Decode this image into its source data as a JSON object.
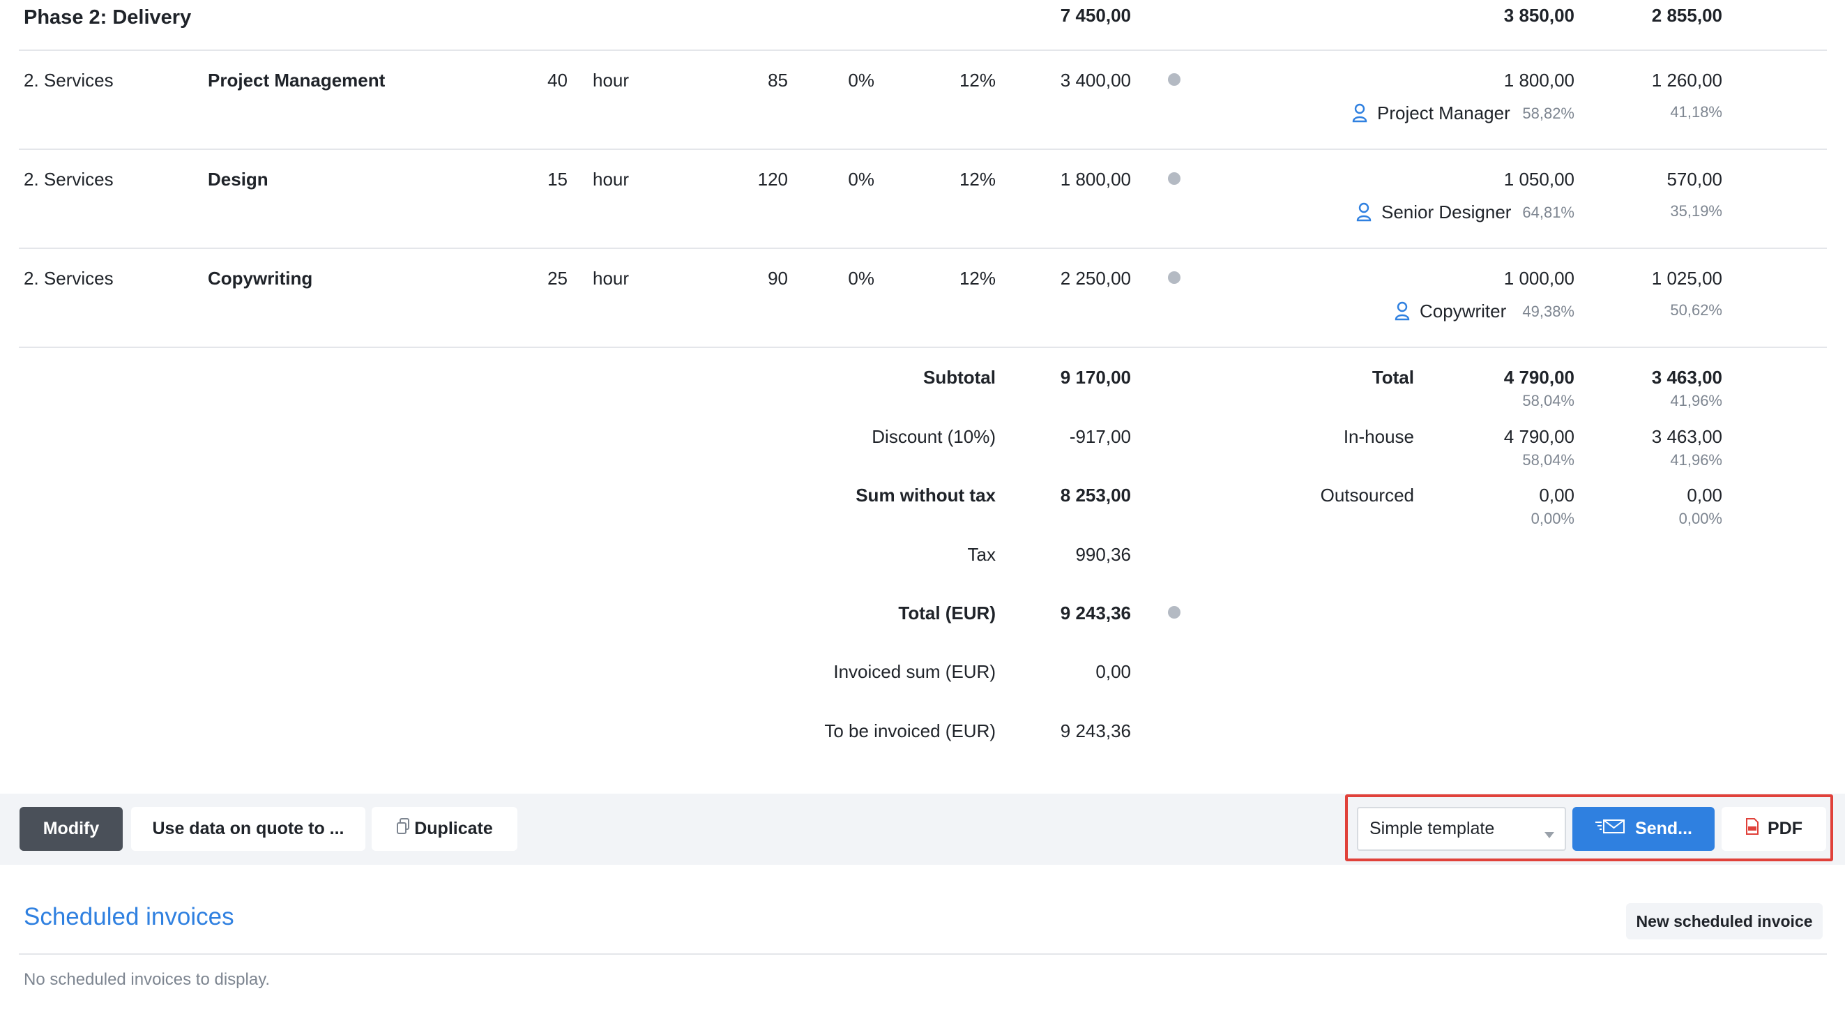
{
  "phase": {
    "title": "Phase 2: Delivery",
    "price": "7 450,00",
    "cost": "3 850,00",
    "margin": "2 855,00"
  },
  "rows": [
    {
      "category": "2. Services",
      "name": "Project Management",
      "qty": "40",
      "unit": "hour",
      "unit_price": "85",
      "discount": "0%",
      "tax": "12%",
      "amount": "3 400,00",
      "cost": "1 800,00",
      "margin": "1 260,00",
      "role": "Project Manager",
      "cost_pct": "58,82%",
      "margin_pct": "41,18%"
    },
    {
      "category": "2. Services",
      "name": "Design",
      "qty": "15",
      "unit": "hour",
      "unit_price": "120",
      "discount": "0%",
      "tax": "12%",
      "amount": "1 800,00",
      "cost": "1 050,00",
      "margin": "570,00",
      "role": "Senior Designer",
      "cost_pct": "64,81%",
      "margin_pct": "35,19%"
    },
    {
      "category": "2. Services",
      "name": "Copywriting",
      "qty": "25",
      "unit": "hour",
      "unit_price": "90",
      "discount": "0%",
      "tax": "12%",
      "amount": "2 250,00",
      "cost": "1 000,00",
      "margin": "1 025,00",
      "role": "Copywriter",
      "cost_pct": "49,38%",
      "margin_pct": "50,62%"
    }
  ],
  "totals": {
    "subtotal_label": "Subtotal",
    "subtotal": "9 170,00",
    "discount_label": "Discount (10%)",
    "discount": "-917,00",
    "sum_without_tax_label": "Sum without tax",
    "sum_without_tax": "8 253,00",
    "tax_label": "Tax",
    "tax": "990,36",
    "total_label": "Total (EUR)",
    "total": "9 243,36",
    "invoiced_label": "Invoiced sum (EUR)",
    "invoiced": "0,00",
    "to_invoice_label": "To be invoiced (EUR)",
    "to_invoice": "9 243,36"
  },
  "breakdown": {
    "total": {
      "label": "Total",
      "cost": "4 790,00",
      "cost_pct": "58,04%",
      "margin": "3 463,00",
      "margin_pct": "41,96%"
    },
    "inhouse": {
      "label": "In-house",
      "cost": "4 790,00",
      "cost_pct": "58,04%",
      "margin": "3 463,00",
      "margin_pct": "41,96%"
    },
    "outsourced": {
      "label": "Outsourced",
      "cost": "0,00",
      "cost_pct": "0,00%",
      "margin": "0,00",
      "margin_pct": "0,00%"
    }
  },
  "actions": {
    "modify": "Modify",
    "use_data": "Use data on quote to ...",
    "duplicate": "Duplicate",
    "template_value": "Simple template",
    "send": "Send...",
    "pdf": "PDF"
  },
  "scheduled": {
    "title": "Scheduled invoices",
    "new_button": "New scheduled invoice",
    "empty": "No scheduled invoices to display."
  },
  "colors": {
    "accent": "#2f80e0",
    "highlight": "#e0413a",
    "dark_button": "#4a5059"
  },
  "icons": [
    "person-icon",
    "status-dot-icon",
    "duplicate-icon",
    "send-envelope-icon",
    "pdf-icon",
    "dropdown-caret-icon"
  ]
}
